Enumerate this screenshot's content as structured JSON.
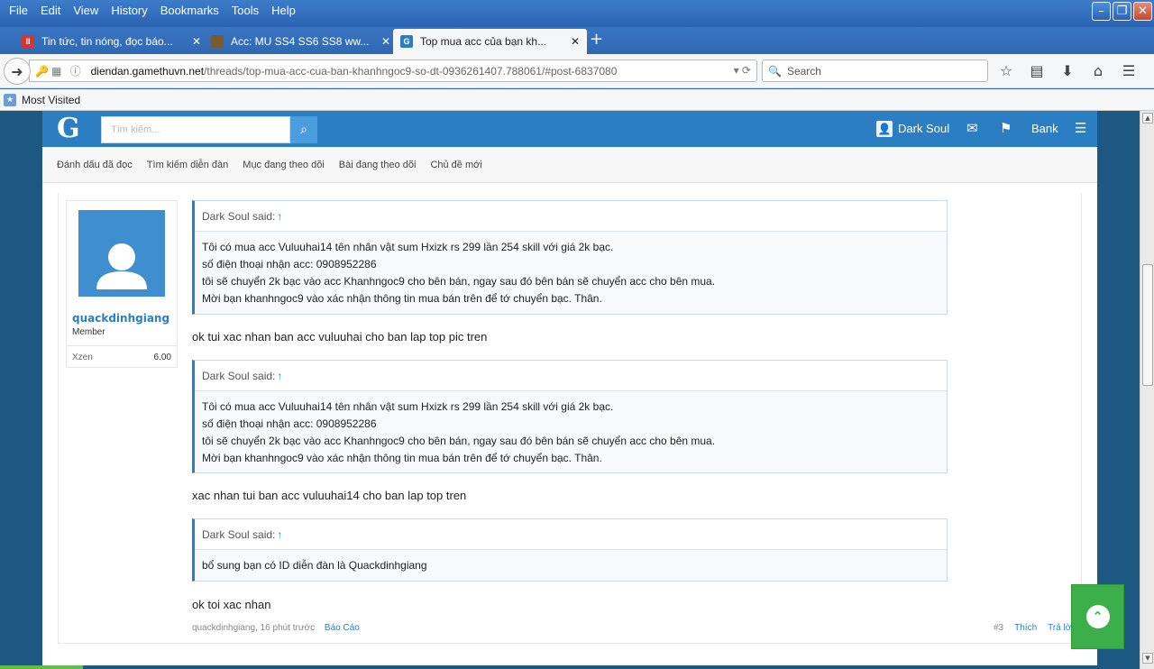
{
  "menu": [
    "File",
    "Edit",
    "View",
    "History",
    "Bookmarks",
    "Tools",
    "Help"
  ],
  "tabs": [
    {
      "title": "Tin tức, tin nóng, đọc báo...",
      "icon_name": "news-site-icon",
      "icon_text": "II",
      "icon_color": "#d9362b"
    },
    {
      "title": "Acc: MU SS4 SS6 SS8 ww...",
      "icon_name": "game-site-icon",
      "icon_text": "",
      "icon_color": "#7a5b2e"
    },
    {
      "title": "Top mua acc của bạn kh...",
      "icon_name": "gamethuvn-site-icon",
      "icon_text": "G",
      "icon_color": "#2c7ec2"
    }
  ],
  "url": {
    "domain": "diendan.gamethuvn.net",
    "path": "/threads/top-mua-acc-cua-ban-khanhngoc9-so-dt-0936261407.788061/#post-6837080"
  },
  "search": {
    "placeholder": "Search"
  },
  "bookmarks": {
    "most_visited": "Most Visited"
  },
  "forum": {
    "logo": "G",
    "search_placeholder": "Tìm kiếm...",
    "user": "Dark Soul",
    "bank": "Bank",
    "subnav": [
      "Đánh dấu đã đọc",
      "Tìm kiếm diễn đàn",
      "Mục đang theo dõi",
      "Bài đang theo dõi",
      "Chủ đề mới"
    ]
  },
  "post": {
    "author": "quackdinhgiang",
    "role": "Member",
    "xzen_label": "Xzen",
    "xzen_value": "6.00",
    "quotes": [
      {
        "head": "Dark Soul said:",
        "lines": [
          "Tôi có mua acc Vuluuhai14 tên nhân vật sum Hxizk rs 299 lần 254 skill với giá 2k bạc.",
          "số điện thoại nhận acc: 0908952286",
          "tôi sẽ chuyển 2k bạc vào acc Khanhngoc9 cho bên bán, ngay sau đó bên bán sẽ chuyển acc cho bên mua.",
          "Mời bạn khanhngoc9 vào xác nhận thông tin mua bán trên để tớ chuyển bạc. Thân."
        ],
        "reply": "ok tui xac nhan ban acc vuluuhai cho ban lap top pic tren"
      },
      {
        "head": "Dark Soul said:",
        "lines": [
          "Tôi có mua acc Vuluuhai14 tên nhân vật sum Hxizk rs 299 lần 254 skill với giá 2k bạc.",
          "số điện thoại nhận acc: 0908952286",
          "tôi sẽ chuyển 2k bạc vào acc Khanhngoc9 cho bên bán, ngay sau đó bên bán sẽ chuyển acc cho bên mua.",
          "Mời bạn khanhngoc9 vào xác nhận thông tin mua bán trên để tớ chuyển bạc. Thân."
        ],
        "reply": "xac nhan tui ban acc vuluuhai14 cho ban lap top tren"
      },
      {
        "head": "Dark Soul said:",
        "lines": [
          "bổ sung bạn có ID diễn đàn là Quackdinhgiang"
        ],
        "reply": "ok toi xac nhan"
      }
    ],
    "footer_meta": "quackdinhgiang, 16 phút trước",
    "report": "Báo Cáo",
    "post_number": "#3",
    "like": "Thích",
    "reply_link": "Trả lời"
  },
  "colors": {
    "forum_blue": "#2c7ec2",
    "scroll_top_green": "#3cae4a",
    "page_bg": "#1d5883"
  }
}
